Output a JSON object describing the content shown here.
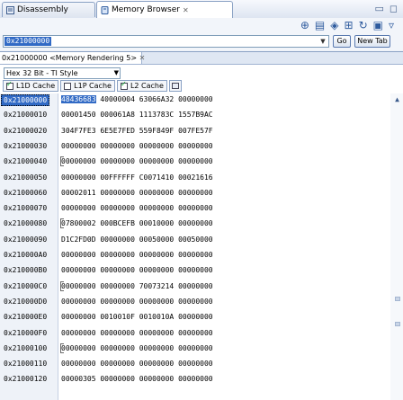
{
  "tabs": [
    {
      "label": "Disassembly"
    },
    {
      "label": "Memory Browser",
      "close": "✕"
    }
  ],
  "window_controls": {
    "minimize": "▭",
    "maximize": "◻"
  },
  "toolbar": {
    "icons": [
      "add-monitor-icon",
      "new-rendering-icon",
      "format-icon",
      "save-icon",
      "refresh-icon",
      "layout-icon",
      "view-menu-icon"
    ]
  },
  "address_bar": {
    "value": "0x21000000",
    "go_label": "Go",
    "new_tab_label": "New Tab"
  },
  "rendering": {
    "tab_label": "0x21000000 <Memory Rendering 5>",
    "tab_close": "✕",
    "style": "Hex 32 Bit - TI Style",
    "caches": [
      {
        "label": "L1D Cache",
        "checked": true
      },
      {
        "label": "L1P Cache",
        "checked": false
      },
      {
        "label": "L2 Cache",
        "checked": true
      }
    ]
  },
  "memory": {
    "selected_address": "0x21000000",
    "highlight_word": "48436683",
    "rows": [
      {
        "addr": "0x21000000",
        "words": [
          "48436683",
          "40000004",
          "63066A32",
          "00000000"
        ]
      },
      {
        "addr": "0x21000010",
        "words": [
          "00001450",
          "000061A8",
          "1113783C",
          "1557B9AC"
        ]
      },
      {
        "addr": "0x21000020",
        "words": [
          "304F7FE3",
          "6E5E7FED",
          "559F849F",
          "007FE57F"
        ]
      },
      {
        "addr": "0x21000030",
        "words": [
          "00000000",
          "00000000",
          "00000000",
          "00000000"
        ]
      },
      {
        "addr": "0x21000040",
        "words": [
          "00000000",
          "00000000",
          "00000000",
          "00000000"
        ]
      },
      {
        "addr": "0x21000050",
        "words": [
          "00000000",
          "00FFFFFF",
          "C0071410",
          "00021616"
        ]
      },
      {
        "addr": "0x21000060",
        "words": [
          "00002011",
          "00000000",
          "00000000",
          "00000000"
        ]
      },
      {
        "addr": "0x21000070",
        "words": [
          "00000000",
          "00000000",
          "00000000",
          "00000000"
        ]
      },
      {
        "addr": "0x21000080",
        "words": [
          "07800002",
          "000BCEFB",
          "00010000",
          "00000000"
        ]
      },
      {
        "addr": "0x21000090",
        "words": [
          "D1C2FD0D",
          "00000000",
          "00050000",
          "00050000"
        ]
      },
      {
        "addr": "0x210000A0",
        "words": [
          "00000000",
          "00000000",
          "00000000",
          "00000000"
        ]
      },
      {
        "addr": "0x210000B0",
        "words": [
          "00000000",
          "00000000",
          "00000000",
          "00000000"
        ]
      },
      {
        "addr": "0x210000C0",
        "words": [
          "00000000",
          "00000000",
          "70073214",
          "00000000"
        ]
      },
      {
        "addr": "0x210000D0",
        "words": [
          "00000000",
          "00000000",
          "00000000",
          "00000000"
        ]
      },
      {
        "addr": "0x210000E0",
        "words": [
          "00000000",
          "0010010F",
          "0010010A",
          "00000000"
        ]
      },
      {
        "addr": "0x210000F0",
        "words": [
          "00000000",
          "00000000",
          "00000000",
          "00000000"
        ]
      },
      {
        "addr": "0x21000100",
        "words": [
          "00000000",
          "00000000",
          "00000000",
          "00000000"
        ]
      },
      {
        "addr": "0x21000110",
        "words": [
          "00000000",
          "00000000",
          "00000000",
          "00000000"
        ]
      },
      {
        "addr": "0x21000120",
        "words": [
          "00000305",
          "00000000",
          "00000000",
          "00000000"
        ]
      }
    ],
    "bracket_rows": [
      4,
      8,
      12,
      16
    ]
  },
  "colors": {
    "selection": "#316ac5",
    "frame": "#8aa1c4"
  }
}
